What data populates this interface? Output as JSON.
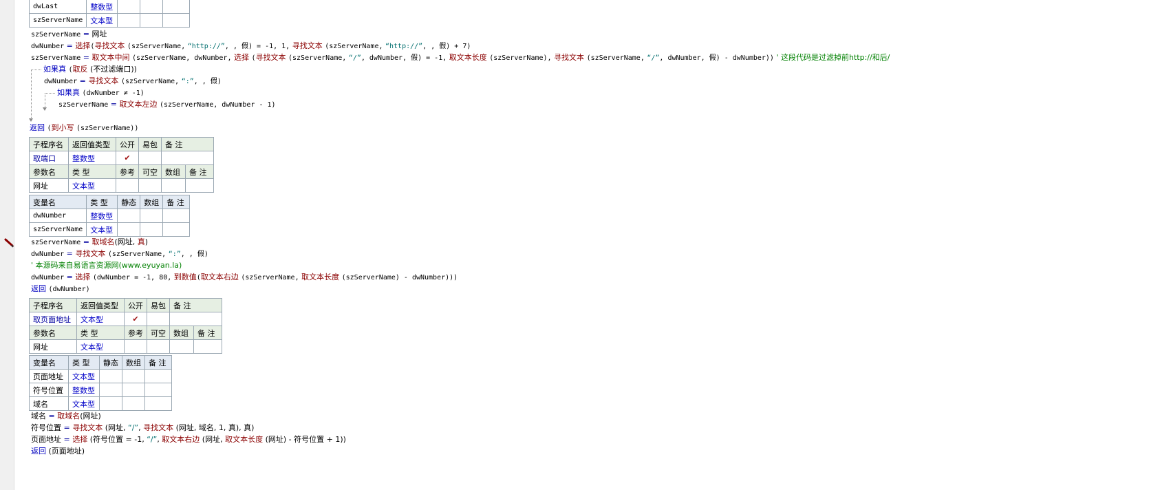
{
  "colors": {
    "function": "#8b0000",
    "keyword": "#0000c0",
    "string": "#006e6e",
    "comment": "#008000",
    "type": "#0000c8",
    "header_bg": "#e6efe3"
  },
  "top_vars": [
    {
      "name": "dwLast",
      "type": "整数型"
    },
    {
      "name": "szServerName",
      "type": "文本型"
    }
  ],
  "block1": {
    "l1": {
      "var": "szServerName",
      "op": "=",
      "rhs": "网址"
    },
    "l2": {
      "var": "dwNumber",
      "op": "=",
      "f1": "选择",
      "p1": "(",
      "f2": "寻找文本",
      "a1": "(szServerName,",
      "s1": "“http://”",
      "a2": ", , 假) = -1, 1,",
      "f3": "寻找文本",
      "a3": "(szServerName,",
      "s2": "“http://”",
      "a4": ", , 假) + 7)"
    },
    "l3": {
      "var": "szServerName",
      "op": "=",
      "f1": "取文本中间",
      "a1": "(szServerName, dwNumber,",
      "f2": "选择",
      "a2": "(",
      "f3": "寻找文本",
      "a3": "(szServerName,",
      "s1": "“/”",
      "a4": ", dwNumber, 假) = -1,",
      "f4": "取文本长度",
      "a5": "(szServerName),",
      "f5": "寻找文本",
      "a6": "(szServerName,",
      "s2": "“/”",
      "a7": ", dwNumber, 假) - dwNumber))",
      "cm": "' 这段代码是过滤掉前http://和后/"
    },
    "l4": {
      "kw": "如果真",
      "p": "(",
      "f": "取反",
      "a": "(不过滤端口))"
    },
    "l5": {
      "var": "dwNumber",
      "op": "=",
      "f": "寻找文本",
      "a1": "(szServerName,",
      "s": "“:”",
      "a2": ", , 假)"
    },
    "l6": {
      "kw": "如果真",
      "a": "(dwNumber ≠ -1)"
    },
    "l7": {
      "var": "szServerName",
      "op": "=",
      "f": "取文本左边",
      "a": "(szServerName, dwNumber - 1)"
    },
    "l8": {
      "kw": "返回",
      "p": "(",
      "f": "到小写",
      "a": "(szServerName))"
    }
  },
  "sub1": {
    "headers": [
      "子程序名",
      "返回值类型",
      "公开",
      "易包",
      "备 注"
    ],
    "name": "取端口",
    "ret": "整数型",
    "check": "✔",
    "param_headers": [
      "参数名",
      "类 型",
      "参考",
      "可空",
      "数组",
      "备 注"
    ],
    "param": {
      "name": "网址",
      "type": "文本型"
    },
    "var_headers": [
      "变量名",
      "类 型",
      "静态",
      "数组",
      "备 注"
    ],
    "vars": [
      {
        "name": "dwNumber",
        "type": "整数型"
      },
      {
        "name": "szServerName",
        "type": "文本型"
      }
    ]
  },
  "block2": {
    "l1": {
      "var": "szServerName",
      "op": "=",
      "f": "取域名",
      "a": "(网址,",
      "kw": "真",
      ")": ")"
    },
    "l2": {
      "var": "dwNumber",
      "op": "=",
      "f": "寻找文本",
      "a1": "(szServerName,",
      "s": "“:”",
      "a2": ", , 假)"
    },
    "l3": {
      "cm": "' 本源码来自易语言资源网(www.eyuyan.la)"
    },
    "l4": {
      "var": "dwNumber",
      "op": "=",
      "f1": "选择",
      "a1": "(dwNumber = -1, 80,",
      "f2": "到数值",
      "a2": "(",
      "f3": "取文本右边",
      "a3": "(szServerName,",
      "f4": "取文本长度",
      "a4": "(szServerName) - dwNumber)))"
    },
    "l5": {
      "kw": "返回",
      "a": "(dwNumber)"
    }
  },
  "sub2": {
    "headers": [
      "子程序名",
      "返回值类型",
      "公开",
      "易包",
      "备 注"
    ],
    "name": "取页面地址",
    "ret": "文本型",
    "check": "✔",
    "param_headers": [
      "参数名",
      "类 型",
      "参考",
      "可空",
      "数组",
      "备 注"
    ],
    "param": {
      "name": "网址",
      "type": "文本型"
    },
    "var_headers": [
      "变量名",
      "类 型",
      "静态",
      "数组",
      "备 注"
    ],
    "vars": [
      {
        "name": "页面地址",
        "type": "文本型"
      },
      {
        "name": "符号位置",
        "type": "整数型"
      },
      {
        "name": "域名",
        "type": "文本型"
      }
    ]
  },
  "block3": {
    "l1": {
      "var": "域名",
      "op": "=",
      "f": "取域名",
      "a": "(网址)"
    },
    "l2": {
      "var": "符号位置",
      "op": "=",
      "f1": "寻找文本",
      "a1": "(网址,",
      "s": "“/”",
      "a2": ",",
      "f2": "寻找文本",
      "a3": "(网址, 域名, 1, 真), 真)"
    },
    "l3": {
      "var": "页面地址",
      "op": "=",
      "f1": "选择",
      "a1": "(符号位置 = -1,",
      "s": "“/”",
      "a2": ",",
      "f2": "取文本右边",
      "a3": "(网址,",
      "f3": "取文本长度",
      "a4": "(网址) - 符号位置 + 1))"
    },
    "l4": {
      "kw": "返回",
      "a": "(页面地址)"
    }
  }
}
